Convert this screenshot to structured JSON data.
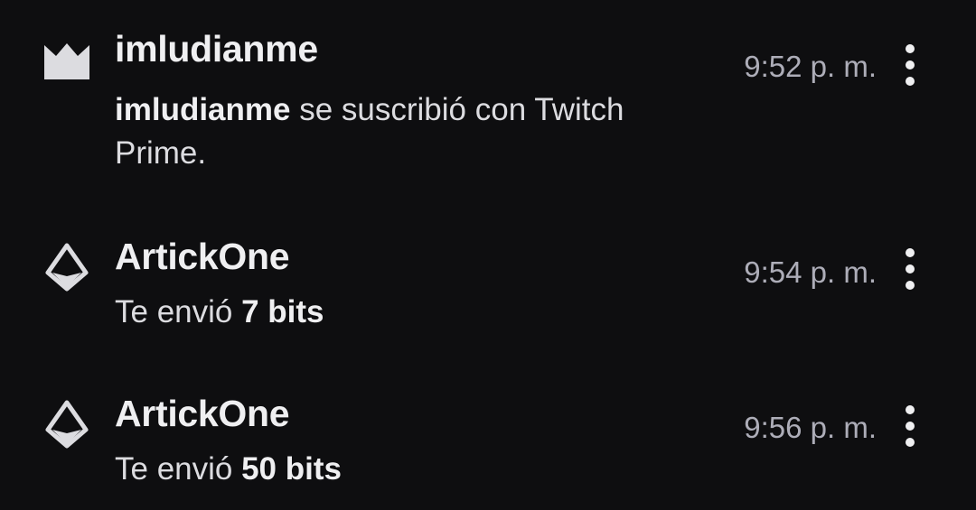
{
  "notifications": [
    {
      "icon": "crown-icon",
      "name": "imludianme",
      "message_bold": "imludianme",
      "message_rest": " se suscribió con Twitch Prime.",
      "time": "9:52 p. m."
    },
    {
      "icon": "bits-gem-icon",
      "name": "ArtickOne",
      "message_prefix": "Te envió ",
      "message_bold": "7 bits",
      "time": "9:54 p. m."
    },
    {
      "icon": "bits-gem-icon",
      "name": "ArtickOne",
      "message_prefix": "Te envió ",
      "message_bold": "50 bits",
      "time": "9:56 p. m."
    }
  ],
  "colors": {
    "background": "#0e0e10",
    "text_primary": "#efeff1",
    "text_secondary": "#adadb8",
    "icon": "#dcdce0"
  }
}
